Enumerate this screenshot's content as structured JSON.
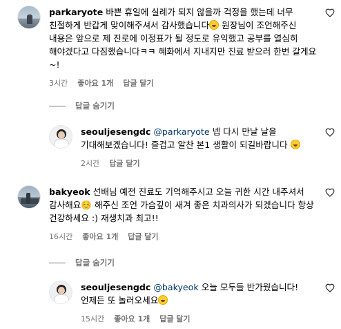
{
  "comments": [
    {
      "username": "parkaryote",
      "text": "바쁜 휴일에 실례가 되지 않을까 걱정을 했는데 너무 친절하게 반갑게 맞이해주셔서 감사했습니다",
      "text_after_emoji": " 원장님이 조언해주신 내용은 앞으로 제 진로에 이정표가 될 정도로 유익했고 공부를 열심히 해야겠다고 다짐했습니다ㅋㅋ 혜화에서 지내지만 진료 받으러 한번 갈게요~!",
      "time": "3시간",
      "likes": "좋아요 1개",
      "reply_label": "답글 달기",
      "toggle_label": "답글 숨기기"
    },
    {
      "username": "seouljesengdc",
      "mention": "@parkaryote",
      "text": " 넵 다시 만날 날을 기대해보겠습니다! 즐겁고 알찬 본1 생활이 되길바랍니다",
      "time": "2시간",
      "reply_label": "답글 달기"
    },
    {
      "username": "bakyeok",
      "text": "선배님 예전 진료도 기억해주시고 오늘 귀한 시간 내주셔서 감사해요☺️ 해주신 조언 가슴깊이 새겨 좋은 치과의사가 되겠습니다 항상 건강하세요 :) 재생치과 최고!!",
      "time": "16시간",
      "likes": "좋아요 1개",
      "reply_label": "답글 달기",
      "toggle_label": "답글 숨기기"
    },
    {
      "username": "seouljesengdc",
      "mention": "@bakyeok",
      "text": " 오늘 모두들 반가웠습니다! 언제든 또 놀러오세요",
      "time": "15시간",
      "likes": "좋아요 1개",
      "reply_label": "답글 달기"
    }
  ],
  "icons": {
    "like": "heart-outline-icon",
    "emoji": "grinning-face-emoji"
  },
  "colors": {
    "meta": "#737373",
    "mention": "#00376b"
  }
}
